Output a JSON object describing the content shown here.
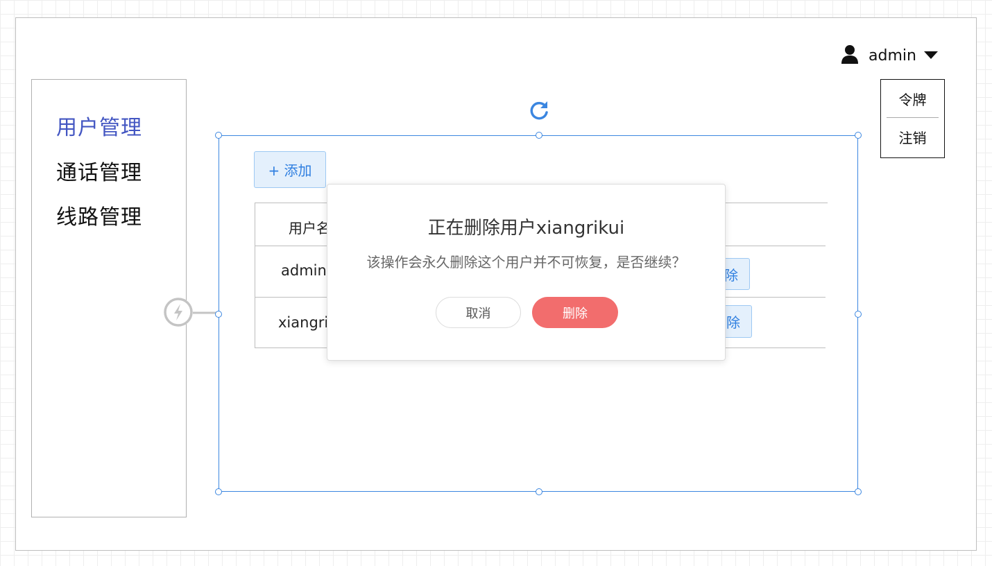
{
  "sidebar": {
    "items": [
      {
        "label": "用户管理",
        "active": true
      },
      {
        "label": "通话管理",
        "active": false
      },
      {
        "label": "线路管理",
        "active": false
      }
    ]
  },
  "header": {
    "user": {
      "icon": "user-icon",
      "name": "admin",
      "caret_icon": "caret-down-icon"
    },
    "dropdown": {
      "items": [
        "令牌",
        "注销"
      ]
    }
  },
  "main": {
    "add_button": "+ 添加",
    "table": {
      "header_first_col": "用户名",
      "rows": [
        {
          "username": "admin",
          "action": "删除"
        },
        {
          "username": "xiangrikui",
          "action": "删除"
        }
      ]
    }
  },
  "modal": {
    "title": "正在删除用户xiangrikui",
    "message": "该操作会永久删除这个用户并不可恢复，是否继续？",
    "cancel_label": "取消",
    "confirm_label": "删除"
  },
  "colors": {
    "accent": "#3b86e0",
    "nav_active": "#4356c2",
    "danger": "#f26d6d",
    "button_bg": "#e4f0fc"
  }
}
